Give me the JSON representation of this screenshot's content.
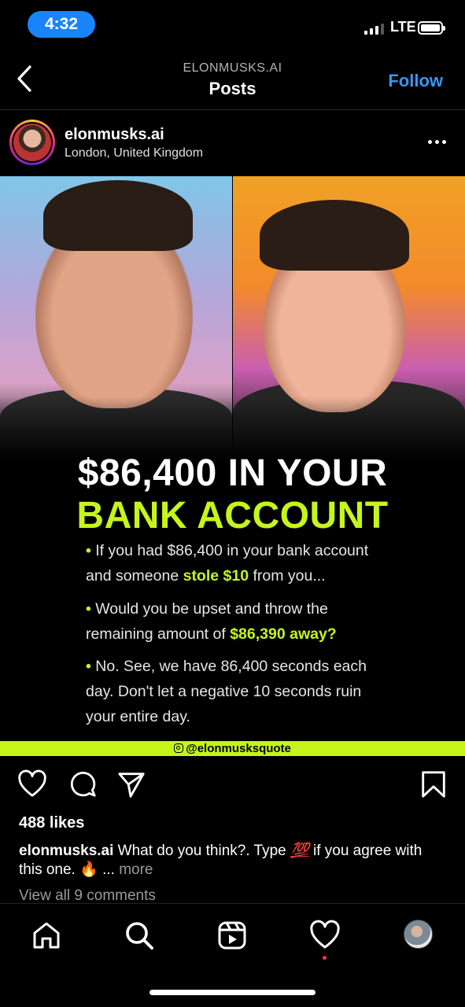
{
  "status_bar": {
    "time": "4:32",
    "network": "LTE"
  },
  "header": {
    "account": "ELONMUSKS.AI",
    "title": "Posts",
    "follow_label": "Follow"
  },
  "post": {
    "username": "elonmusks.ai",
    "location": "London, United Kingdom",
    "image": {
      "headline_line1": "$86,400 IN YOUR",
      "headline_line2": "BANK ACCOUNT",
      "bullets": [
        {
          "pre": "If you had $86,400 in your bank account and someone ",
          "highlight": "stole $10",
          "post": " from you..."
        },
        {
          "pre": "Would you be upset and throw the remaining amount of ",
          "highlight": "$86,390 away?",
          "post": ""
        },
        {
          "pre": "No. See, we have 86,400 seconds each day. Don't let a negative 10 seconds ruin your entire day.",
          "highlight": "",
          "post": ""
        }
      ],
      "watermark": "@elonmusksquote",
      "accent_color": "#c6f51a"
    },
    "likes": "488 likes",
    "caption": {
      "username": "elonmusks.ai",
      "text": "What do you think?. Type",
      "emoji_100": "💯",
      "text2": "if you agree with this one.",
      "emoji_fire": "🔥",
      "ellipsis": "...",
      "more": "more"
    },
    "view_comments": "View all 9 comments"
  },
  "icons": [
    "back-icon",
    "more-options-icon",
    "heart-icon",
    "comment-icon",
    "share-icon",
    "bookmark-icon",
    "home-icon",
    "search-icon",
    "reels-icon",
    "activity-heart-icon",
    "profile-avatar"
  ],
  "colors": {
    "link": "#3897f0",
    "time_pill": "#1a84ff",
    "notification_dot": "#ff3040"
  }
}
